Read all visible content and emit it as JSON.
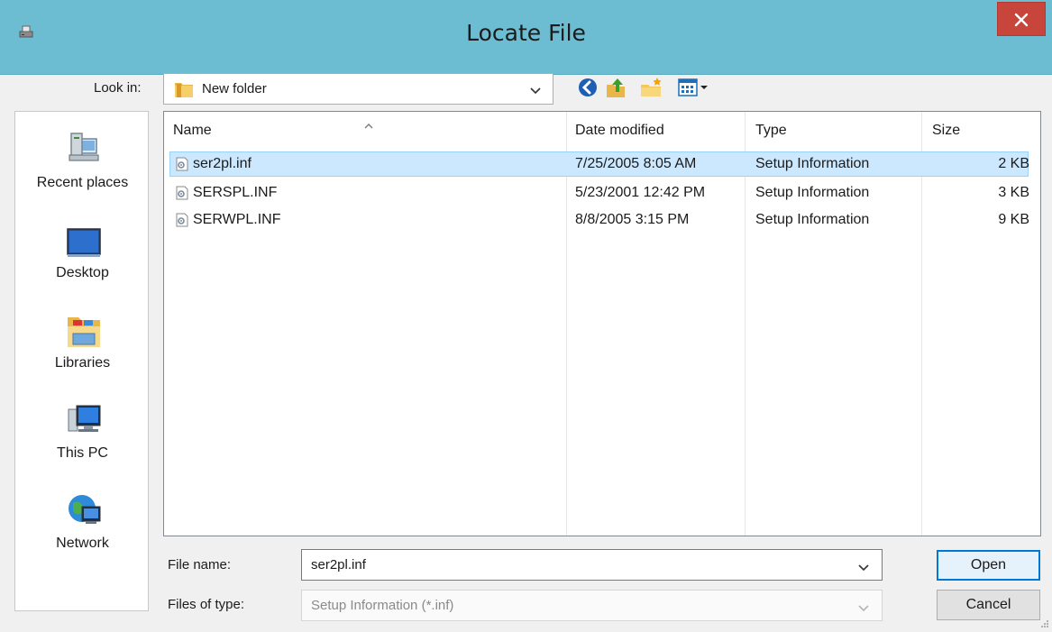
{
  "window": {
    "title": "Locate File",
    "close_label": "✕"
  },
  "toolbar": {
    "look_in_label": "Look in:",
    "look_in_value": "New folder"
  },
  "places": [
    {
      "label": "Recent places",
      "icon": "recent-places-icon"
    },
    {
      "label": "Desktop",
      "icon": "desktop-icon"
    },
    {
      "label": "Libraries",
      "icon": "libraries-icon"
    },
    {
      "label": "This PC",
      "icon": "this-pc-icon"
    },
    {
      "label": "Network",
      "icon": "network-icon"
    }
  ],
  "files": {
    "columns": [
      "Name",
      "Date modified",
      "Type",
      "Size"
    ],
    "rows": [
      {
        "name": "ser2pl.inf",
        "date": "7/25/2005 8:05 AM",
        "type": "Setup Information",
        "size": "2 KB",
        "selected": true
      },
      {
        "name": "SERSPL.INF",
        "date": "5/23/2001 12:42 PM",
        "type": "Setup Information",
        "size": "3 KB",
        "selected": false
      },
      {
        "name": "SERWPL.INF",
        "date": "8/8/2005 3:15 PM",
        "type": "Setup Information",
        "size": "9 KB",
        "selected": false
      }
    ]
  },
  "footer": {
    "file_name_label": "File name:",
    "file_name_value": "ser2pl.inf",
    "file_type_label": "Files of type:",
    "file_type_value": "Setup Information (*.inf)",
    "open_label": "Open",
    "cancel_label": "Cancel"
  },
  "colors": {
    "titlebar": "#6cbcd2",
    "close": "#c7453a",
    "selection": "#cce8ff",
    "accent": "#0078d7"
  }
}
